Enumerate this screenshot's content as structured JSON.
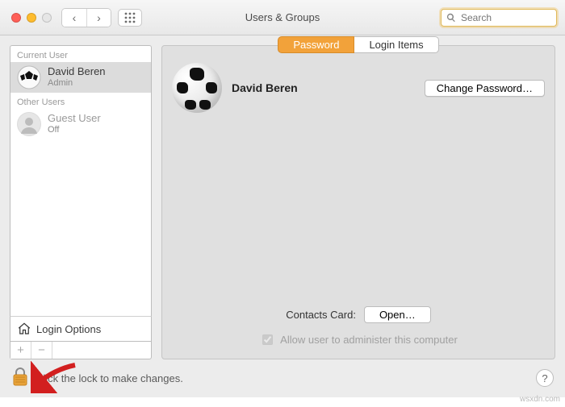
{
  "window": {
    "title": "Users & Groups"
  },
  "search": {
    "placeholder": "Search"
  },
  "sidebar": {
    "current_label": "Current User",
    "other_label": "Other Users",
    "users": [
      {
        "name": "David Beren",
        "role": "Admin"
      },
      {
        "name": "Guest User",
        "role": "Off"
      }
    ],
    "login_options_label": "Login Options"
  },
  "tabs": {
    "password": "Password",
    "login_items": "Login Items"
  },
  "profile": {
    "name": "David Beren",
    "change_password_label": "Change Password…"
  },
  "contacts": {
    "label": "Contacts Card:",
    "open_label": "Open…"
  },
  "admin_checkbox": {
    "label": "Allow user to administer this computer",
    "checked": true
  },
  "lock": {
    "text": "Click the lock to make changes."
  },
  "watermark": "wsxdn.com"
}
